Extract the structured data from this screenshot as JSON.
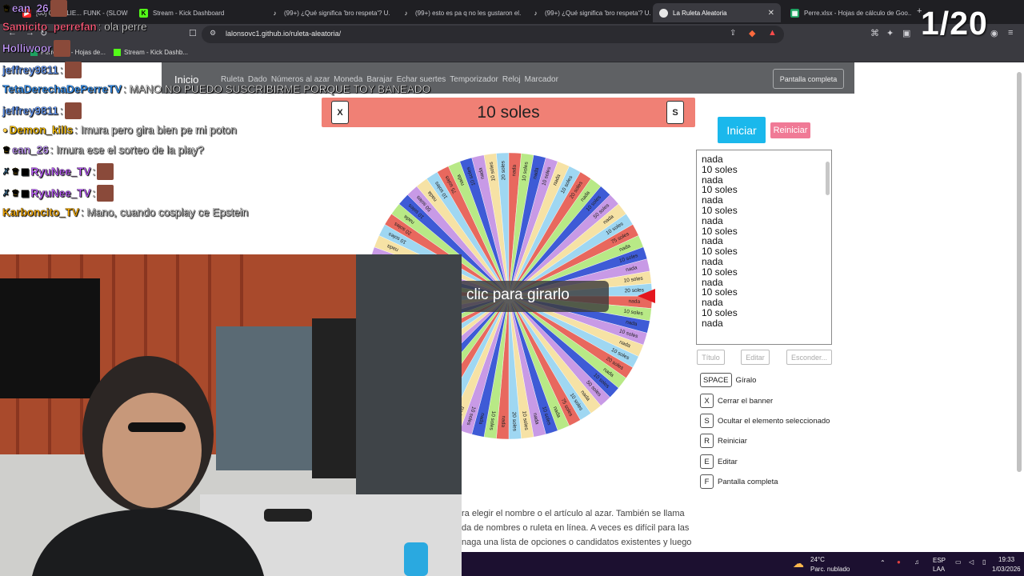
{
  "browser": {
    "tabs": [
      {
        "title": "[60] CHARLIE... FUNK - (SLOWE...",
        "icon": "youtube-icon",
        "active": false
      },
      {
        "title": "Stream - Kick Dashboard",
        "icon": "kick-icon",
        "active": false
      },
      {
        "title": "(99+) ¿Qué significa 'bro respeta'? U...",
        "icon": "tiktok-icon",
        "active": false
      },
      {
        "title": "(99+) esto es pa q no les gustaron el...",
        "icon": "tiktok-icon",
        "active": false
      },
      {
        "title": "(99+) ¿Qué significa 'bro respeta'? U...",
        "icon": "tiktok-icon",
        "active": false
      },
      {
        "title": "La Ruleta Aleatoria",
        "icon": "site-icon",
        "active": true
      },
      {
        "title": "Perre.xlsx - Hojas de cálculo de Goo...",
        "icon": "sheets-icon",
        "active": false
      }
    ],
    "url": "lalonsovc1.github.io/ruleta-aleatoria/",
    "bookmarks": [
      {
        "label": "Perre.xlsx - Hojas de...",
        "icon": "sheets-icon"
      },
      {
        "label": "Stream - Kick Dashb...",
        "icon": "kick-icon"
      }
    ]
  },
  "overlay": {
    "counter": "1/20"
  },
  "site": {
    "brand": "Inicio",
    "nav": [
      "Ruleta",
      "Dado",
      "Números al azar",
      "Moneda",
      "Barajar",
      "Echar suertes",
      "Temporizador",
      "Reloj",
      "Marcador"
    ],
    "fullscreen_label": "Pantalla completa"
  },
  "banner": {
    "close_key": "X",
    "text": "10 soles",
    "hide_key": "S"
  },
  "wheel": {
    "center_label": "clic para girarlo",
    "segment_labels": [
      "nada",
      "10 soles",
      "20 soles",
      "50 soles",
      "75 soles"
    ]
  },
  "controls": {
    "start": "Iniciar",
    "reset": "Reiniciar",
    "title_btn": "Título",
    "edit_btn": "Editar",
    "hide_btn": "Esconder..."
  },
  "options_list": [
    "nada",
    "10 soles",
    "nada",
    "10 soles",
    "nada",
    "10 soles",
    "nada",
    "10 soles",
    "nada",
    "10 soles",
    "nada",
    "10 soles",
    "nada",
    "10 soles",
    "nada",
    "10 soles",
    "nada"
  ],
  "shortcuts": [
    {
      "key": "SPACE",
      "label": "Gíralo"
    },
    {
      "key": "X",
      "label": "Cerrar el banner"
    },
    {
      "key": "S",
      "label": "Ocultar el elemento seleccionado"
    },
    {
      "key": "R",
      "label": "Reiniciar"
    },
    {
      "key": "E",
      "label": "Editar"
    },
    {
      "key": "F",
      "label": "Pantalla completa"
    }
  ],
  "description": [
    "ra elegir el nombre o el artículo al azar. También se llama",
    "da de nombres o ruleta en línea. A veces es difícil para las",
    "naga una lista de opciones o candidatos existentes y luego"
  ],
  "chat": [
    {
      "user": "ean_26",
      "color": "#c79bff",
      "msg": ""
    },
    {
      "user": "Samicito_perrefan",
      "color": "#ff5b7a",
      "msg": ": ola perre"
    },
    {
      "user": "Holliwoor",
      "color": "#c79bff",
      "msg": ""
    },
    {
      "user": "jeffrey9811",
      "color": "#6aa0ff",
      "msg": ":"
    },
    {
      "user": "TetaDerechaDePerreTV",
      "color": "#3d9cff",
      "msg": ": MANO NO PUEDO SUSCRIBIRME PORQUE TOY BANEADO"
    },
    {
      "user": "jeffrey9811",
      "color": "#6aa0ff",
      "msg": ":"
    },
    {
      "user": "Demon_kills",
      "color": "#ffc300",
      "msg": ": Imura pero gira bien pe mi poton"
    },
    {
      "user": "ean_26",
      "color": "#c79bff",
      "msg": ": Imura ese el sorteo de la play?"
    },
    {
      "user": "RyuNee_TV",
      "color": "#c060ff",
      "msg": ":"
    },
    {
      "user": "RyuNee_TV",
      "color": "#c060ff",
      "msg": ":"
    },
    {
      "user": "Karboncito_TV",
      "color": "#ffb000",
      "msg": ": Mano, cuando cosplay ce Epstein"
    }
  ],
  "taskbar": {
    "weather_temp": "24°C",
    "weather_desc": "Parc. nublado",
    "lang": "ESP",
    "lang2": "LAA",
    "time": "19:33",
    "date": "1/03/2026"
  },
  "colors": {
    "banner": "#f08075",
    "start": "#1ab8ec",
    "reset": "#f07a96",
    "wheel": [
      "#e8685e",
      "#b8e986",
      "#3e5bd6",
      "#c89ae6",
      "#f6e2a5",
      "#9fd7f2"
    ]
  }
}
